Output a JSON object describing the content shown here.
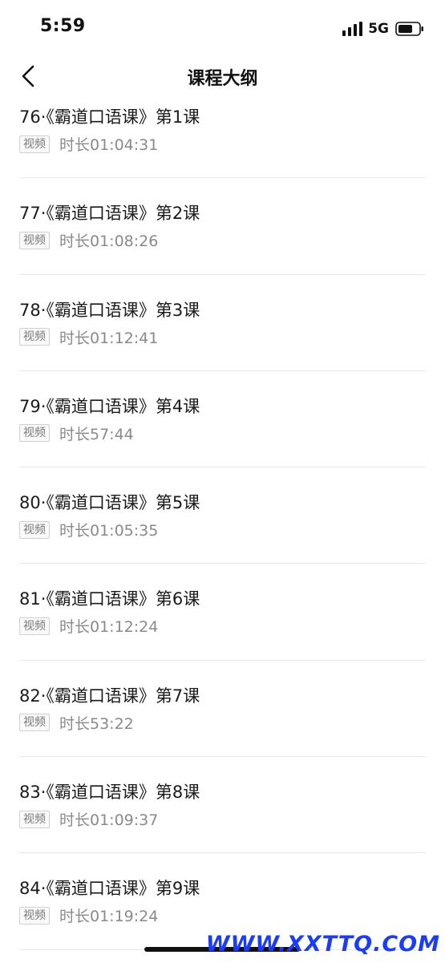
{
  "status_bar": {
    "time": "5:59",
    "network": "5G",
    "signal_icon": "signal-bars-icon",
    "battery_icon": "battery-icon"
  },
  "nav": {
    "back_icon": "chevron-left-icon",
    "title": "课程大纲"
  },
  "lessons": [
    {
      "title": "76·《霸道口语课》第1课",
      "type": "视频",
      "duration": "时长01:04:31"
    },
    {
      "title": "77·《霸道口语课》第2课",
      "type": "视频",
      "duration": "时长01:08:26"
    },
    {
      "title": "78·《霸道口语课》第3课",
      "type": "视频",
      "duration": "时长01:12:41"
    },
    {
      "title": "79·《霸道口语课》第4课",
      "type": "视频",
      "duration": "时长57:44"
    },
    {
      "title": "80·《霸道口语课》第5课",
      "type": "视频",
      "duration": "时长01:05:35"
    },
    {
      "title": "81·《霸道口语课》第6课",
      "type": "视频",
      "duration": "时长01:12:24"
    },
    {
      "title": "82·《霸道口语课》第7课",
      "type": "视频",
      "duration": "时长53:22"
    },
    {
      "title": "83·《霸道口语课》第8课",
      "type": "视频",
      "duration": "时长01:09:37"
    },
    {
      "title": "84·《霸道口语课》第9课",
      "type": "视频",
      "duration": "时长01:19:24"
    }
  ],
  "watermark": "WWW.XXTTQ.COM",
  "colors": {
    "watermark": "#1a3cff",
    "text_primary": "#1a1a1a",
    "text_secondary": "#8a8a8a",
    "divider": "#e6e6e6"
  }
}
